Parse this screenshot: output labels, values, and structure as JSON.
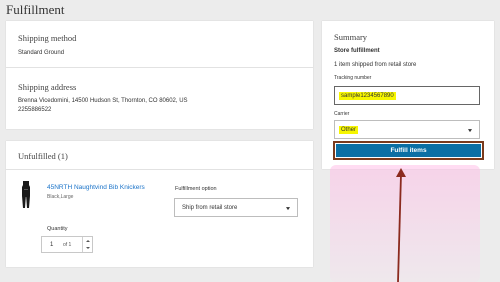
{
  "page": {
    "title": "Fulfillment"
  },
  "shipping_method": {
    "heading": "Shipping method",
    "value": "Standard Ground"
  },
  "shipping_address": {
    "heading": "Shipping address",
    "address_line": "Brenna Vicedomini, 14500 Hudson St, Thornton, CO 80602, US",
    "phone": "2255886522"
  },
  "unfulfilled": {
    "heading": "Unfulfilled (1)",
    "item": {
      "name": "45NRTH Naughtvind Bib Knickers",
      "variant": "Black,Large",
      "fulfillment_option_label": "Fulfillment option",
      "fulfillment_option_value": "Ship from retail store",
      "quantity_label": "Quantity",
      "quantity_value": "1",
      "quantity_of": "of 1"
    }
  },
  "summary": {
    "heading": "Summary",
    "subheading": "Store fulfillment",
    "description": "1 item shipped from retail store",
    "tracking_label": "Tracking number",
    "tracking_value": "sample1234567890",
    "carrier_label": "Carrier",
    "carrier_value": "Other",
    "button_label": "Fulfill items"
  },
  "colors": {
    "accent": "#0b6fa4",
    "highlight": "#f6f600",
    "annotation": "#8b2a1e",
    "link": "#1a73c9"
  },
  "icons": {
    "product": "bib-knickers-thumbnail",
    "dropdown": "chevron-down-icon",
    "annotation": "arrow-up-icon"
  }
}
